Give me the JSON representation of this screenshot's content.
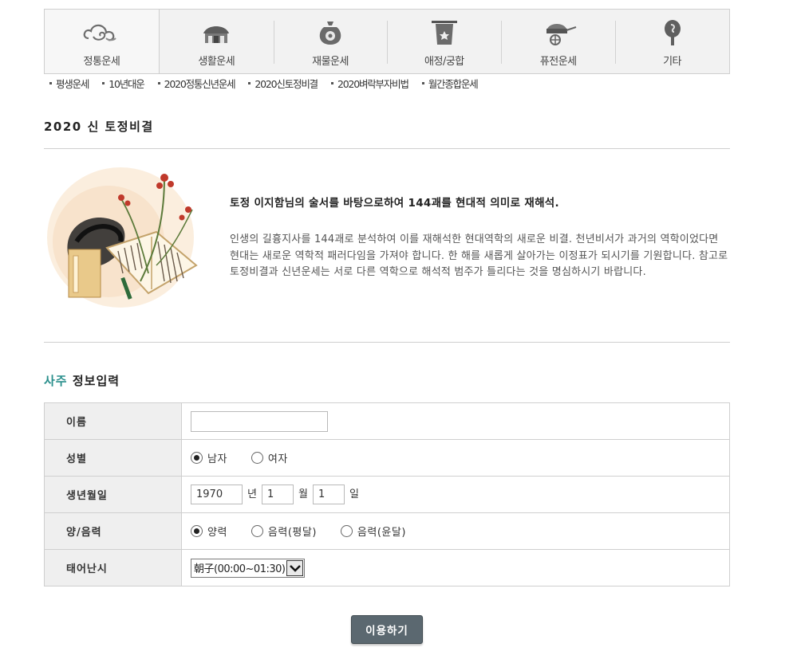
{
  "top_menu": {
    "tabs": [
      {
        "label": "정통운세",
        "icon": "cloud-icon",
        "active": true
      },
      {
        "label": "생활운세",
        "icon": "house-icon",
        "active": false
      },
      {
        "label": "재물운세",
        "icon": "money-bag-icon",
        "active": false
      },
      {
        "label": "애정/궁합",
        "icon": "lantern-icon",
        "active": false
      },
      {
        "label": "퓨전운세",
        "icon": "cart-icon",
        "active": false
      },
      {
        "label": "기타",
        "icon": "bean-icon",
        "active": false
      }
    ]
  },
  "sub_menu": {
    "items": [
      "평생운세",
      "10년대운",
      "2020정통신년운세",
      "2020신토정비결",
      "2020벼락부자비법",
      "월간종합운세"
    ]
  },
  "page_title": "2020 신 토정비결",
  "intro": {
    "heading": "토정 이지함님의 술서를 바탕으로하여 144괘를 현대적 의미로 재해석.",
    "body": "인생의 길흉지사를 144괘로 분석하여 이를 재해석한 현대역학의 새로운 비결. 천년비서가 과거의 역학이었다면 현대는 새로운 역학적 패러다임을 가져야 합니다. 한 해를 새롭게 살아가는 이정표가 되시기를 기원합니다. 참고로 토정비결과 신년운세는 서로 다른 역학으로 해석적 범주가 틀리다는 것을 명심하시기 바랍니다."
  },
  "form": {
    "title_accent": "사주",
    "title_rest": "정보입력",
    "name_label": "이름",
    "name_value": "",
    "gender_label": "성별",
    "gender_male": "남자",
    "gender_female": "여자",
    "gender_selected": "male",
    "birth_label": "생년월일",
    "birth_year": "1970",
    "year_unit": "년",
    "birth_month": "1",
    "month_unit": "월",
    "birth_day": "1",
    "day_unit": "일",
    "calendar_label": "양/음력",
    "calendar_solar": "양력",
    "calendar_lunar_normal": "음력(평달)",
    "calendar_lunar_leap": "음력(윤달)",
    "calendar_selected": "solar",
    "time_label": "태어난시",
    "time_value": "朝子(00:00~01:30)"
  },
  "submit_label": "이용하기",
  "colors": {
    "accent": "#2a8f8c",
    "button_bg": "#5b6870",
    "label_bg": "#efefef",
    "border": "#cfcfcf"
  }
}
